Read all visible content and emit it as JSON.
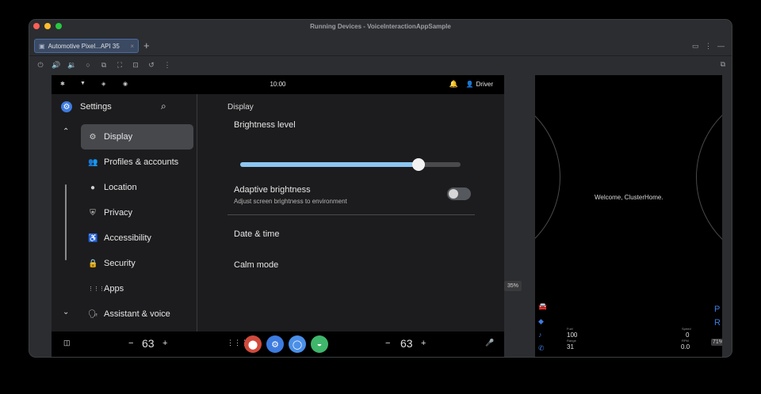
{
  "window": {
    "title": "Running Devices - VoiceInteractionAppSample",
    "tab_label": "Automotive Pixel...API 35",
    "tab_close": "×",
    "new_tab": "+"
  },
  "colors": {
    "accent": "#3d7be0",
    "slider_fill": "#8cc6f0",
    "traffic_red": "#ff5f57",
    "traffic_yellow": "#febc2e",
    "traffic_green": "#28c840"
  },
  "status_bar": {
    "time": "10:00",
    "user": "Driver"
  },
  "settings": {
    "title": "Settings",
    "nav_items": [
      {
        "label": "Display",
        "icon": "gear-icon",
        "glyph": "⚙"
      },
      {
        "label": "Profiles & accounts",
        "icon": "people-icon",
        "glyph": "👥"
      },
      {
        "label": "Location",
        "icon": "location-pin-icon",
        "glyph": "●"
      },
      {
        "label": "Privacy",
        "icon": "shield-user-icon",
        "glyph": "⛨"
      },
      {
        "label": "Accessibility",
        "icon": "accessibility-icon",
        "glyph": "♿"
      },
      {
        "label": "Security",
        "icon": "lock-icon",
        "glyph": "🔒"
      },
      {
        "label": "Apps",
        "icon": "apps-grid-icon",
        "glyph": "⋮⋮⋮"
      },
      {
        "label": "Assistant & voice",
        "icon": "assistant-icon",
        "glyph": "🗣"
      }
    ]
  },
  "display": {
    "heading": "Display",
    "brightness_label": "Brightness level",
    "brightness_value": 0.81,
    "adaptive_label": "Adaptive brightness",
    "adaptive_sub": "Adjust screen brightness to environment",
    "adaptive_on": false,
    "date_time": "Date & time",
    "calm_mode": "Calm mode"
  },
  "nav_bar": {
    "left_temp": "63",
    "right_temp": "63",
    "minus": "−",
    "plus": "+",
    "side_badge": "35%"
  },
  "cluster": {
    "welcome": "Welcome, ClusterHome.",
    "fuel_label": "Fuel",
    "fuel_value": "100",
    "range_label": "Range",
    "range_value": "31",
    "speed_label": "Speed",
    "speed_value": "0",
    "rpm_label": "RPM",
    "rpm_value": "0.0",
    "gear_p": "P",
    "gear_r": "R",
    "battery_badge": "71%"
  }
}
